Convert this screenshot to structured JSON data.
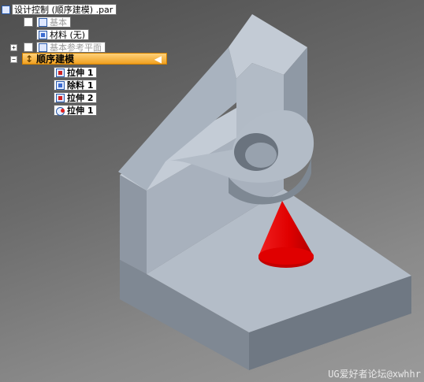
{
  "tree": {
    "root": "设计控制 (顺序建模) .par",
    "base": "基本",
    "material": "材料 (无)",
    "refplanes": "基本参考平面",
    "sequential": "顺序建模",
    "features": [
      {
        "label": "拉伸 1",
        "icon": "extrude-icon"
      },
      {
        "label": "除料 1",
        "icon": "cutout-icon"
      },
      {
        "label": "拉伸 2",
        "icon": "extrude-icon"
      },
      {
        "label": "拉伸 1",
        "icon": "revolve-icon"
      }
    ]
  },
  "watermark": "UG爱好者论坛@xwhhr",
  "colors": {
    "highlight": "#f0a020",
    "cone": "#e00000",
    "part": "#b9c3cf"
  }
}
